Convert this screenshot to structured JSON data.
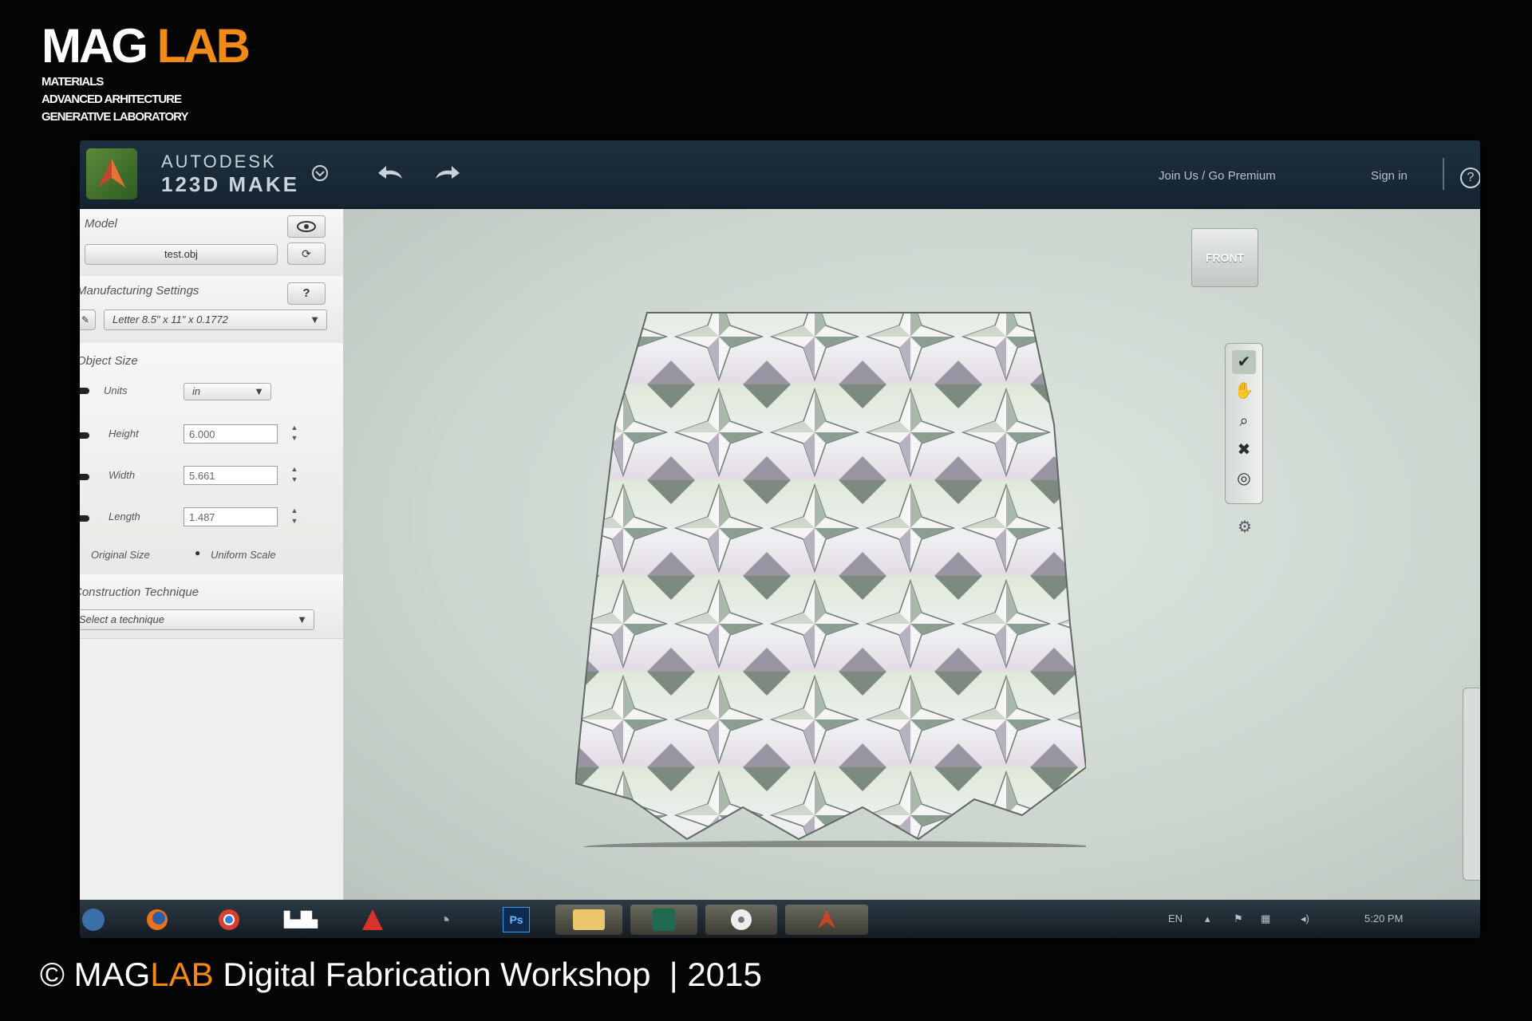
{
  "watermark": {
    "brand_mag": "MAG",
    "brand_lab": "LAB",
    "sub_line1": "MATERIALS",
    "sub_line2": "ADVANCED ARHITECTURE",
    "sub_line3": "GENERATIVE LABORATORY",
    "caption_prefix": "© MAG",
    "caption_lab": "LAB",
    "caption_rest": " Digital Fabrication Workshop  | 2015"
  },
  "app": {
    "brand_line1": "AUTODESK",
    "brand_line2": "123D MAKE",
    "join_link": "Join Us / Go Premium",
    "signin_link": "Sign in"
  },
  "sidebar": {
    "model_label": "Model",
    "model_file": "test.obj",
    "manufacturing_label": "Manufacturing Settings",
    "sheet_select": "Letter 8.5\" x 11\" x 0.1772",
    "object_size_label": "Object Size",
    "units_label": "Units",
    "units_value": "in",
    "height_label": "Height",
    "height_value": "6.000",
    "width_label": "Width",
    "width_value": "5.661",
    "length_label": "Length",
    "length_value": "1.487",
    "original_size_label": "Original Size",
    "uniform_scale_label": "Uniform Scale",
    "construction_label": "Construction Technique",
    "technique_select": "Select a technique"
  },
  "viewport": {
    "front_button": "FRONT"
  },
  "taskbar": {
    "lang": "EN",
    "time": "5:20 PM"
  },
  "colors": {
    "accent_orange": "#f28a18",
    "app_header": "#1d2f3e",
    "viewport_bg": "#cbd6cf"
  }
}
